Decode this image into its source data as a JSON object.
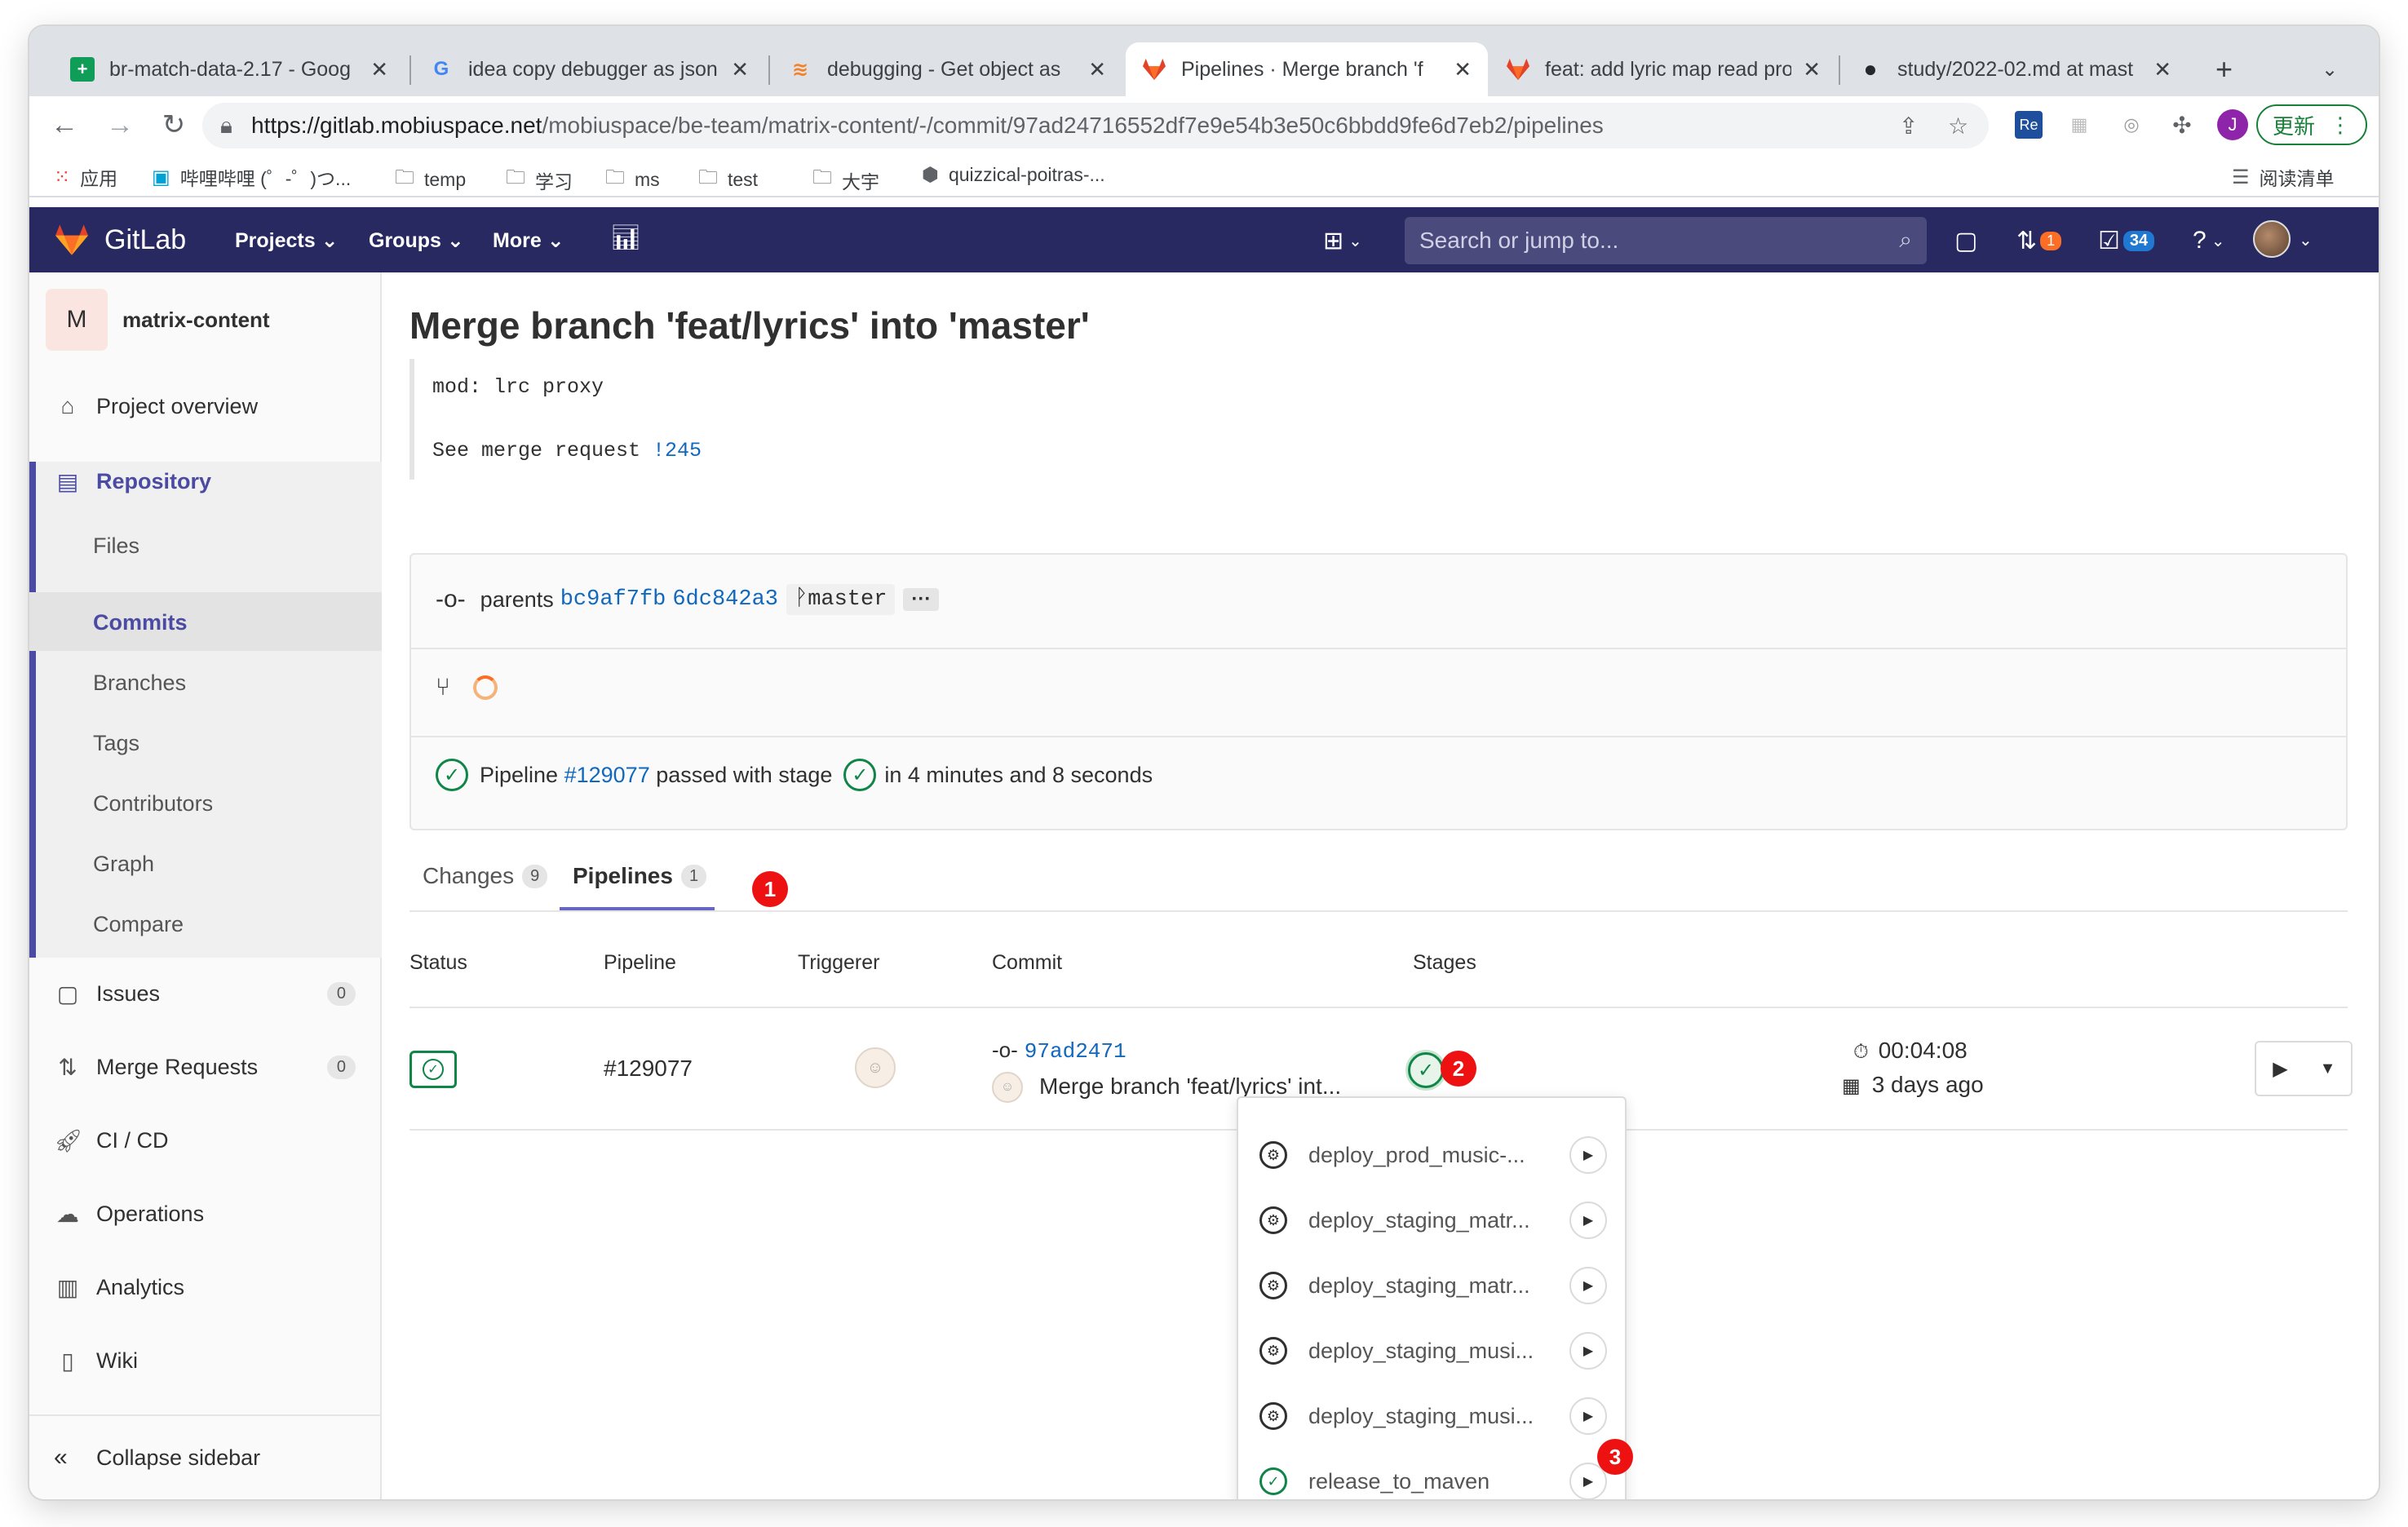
{
  "browser": {
    "tabs": [
      {
        "title": "br-match-data-2.17 - Goog",
        "favicon": "sheets-icon"
      },
      {
        "title": "idea copy debugger as json",
        "favicon": "google-icon"
      },
      {
        "title": "debugging - Get object as",
        "favicon": "stackoverflow-icon"
      },
      {
        "title": "Pipelines · Merge branch 'f",
        "favicon": "gitlab-icon"
      },
      {
        "title": "feat: add lyric map read pro",
        "favicon": "gitlab-icon"
      },
      {
        "title": "study/2022-02.md at mast",
        "favicon": "github-icon"
      }
    ],
    "url_host": "https://gitlab.mobiuspace.net",
    "url_path": "/mobiuspace/be-team/matrix-content/-/commit/97ad24716552df7e9e54b3e50c6bbdd9fe6d7eb2/pipelines",
    "update_label": "更新",
    "profile_initial": "J",
    "bookmarks": [
      "应用",
      "哔哩哔哩 (゜-゜)つ...",
      "temp",
      "学习",
      "ms",
      "test",
      "大宇",
      "quizzical-poitras-...",
      "阅读清单"
    ]
  },
  "gitlab": {
    "logo_text": "GitLab",
    "nav": [
      "Projects",
      "Groups",
      "More"
    ],
    "search_placeholder": "Search or jump to...",
    "mr_count": "1",
    "todo_count": "34"
  },
  "sidebar": {
    "project_initial": "M",
    "project_name": "matrix-content",
    "items": {
      "overview": "Project overview",
      "repository": "Repository",
      "files": "Files",
      "commits": "Commits",
      "branches": "Branches",
      "tags": "Tags",
      "contributors": "Contributors",
      "graph": "Graph",
      "compare": "Compare",
      "issues": "Issues",
      "issues_count": "0",
      "merge_requests": "Merge Requests",
      "mr_count": "0",
      "cicd": "CI / CD",
      "operations": "Operations",
      "analytics": "Analytics",
      "wiki": "Wiki",
      "collapse": "Collapse sidebar"
    }
  },
  "commit": {
    "title": "Merge branch 'feat/lyrics' into 'master'",
    "message_line1": "mod: lrc proxy",
    "message_line2_prefix": "See merge request ",
    "message_line2_link": "!245",
    "parents_label": "parents",
    "parent1": "bc9af7fb",
    "parent2": "6dc842a3",
    "branch": "master",
    "more_dots": "···",
    "pipeline_prefix": "Pipeline",
    "pipeline_link": "#129077",
    "pipeline_mid": "passed with stage",
    "pipeline_suffix": "in 4 minutes and 8 seconds"
  },
  "tabs": [
    {
      "label": "Changes",
      "count": "9"
    },
    {
      "label": "Pipelines",
      "count": "1"
    }
  ],
  "table": {
    "headers": [
      "Status",
      "Pipeline",
      "Triggerer",
      "Commit",
      "Stages"
    ],
    "row": {
      "pipeline_id": "#129077",
      "commit_sha": "97ad2471",
      "commit_title": "Merge branch 'feat/lyrics' int...",
      "duration": "00:04:08",
      "finished": "3 days ago"
    }
  },
  "stage_jobs": [
    {
      "name": "deploy_prod_music-...",
      "status": "manual"
    },
    {
      "name": "deploy_staging_matr...",
      "status": "manual"
    },
    {
      "name": "deploy_staging_matr...",
      "status": "manual"
    },
    {
      "name": "deploy_staging_musi...",
      "status": "manual"
    },
    {
      "name": "deploy_staging_musi...",
      "status": "manual"
    },
    {
      "name": "release_to_maven",
      "status": "success"
    }
  ],
  "markers": [
    "1",
    "2",
    "3"
  ],
  "colors": {
    "gitlab_header": "#292961",
    "sidebar_accent": "#4b4ba3",
    "success": "#108548",
    "link": "#1068bf",
    "marker": "#ee1111"
  }
}
